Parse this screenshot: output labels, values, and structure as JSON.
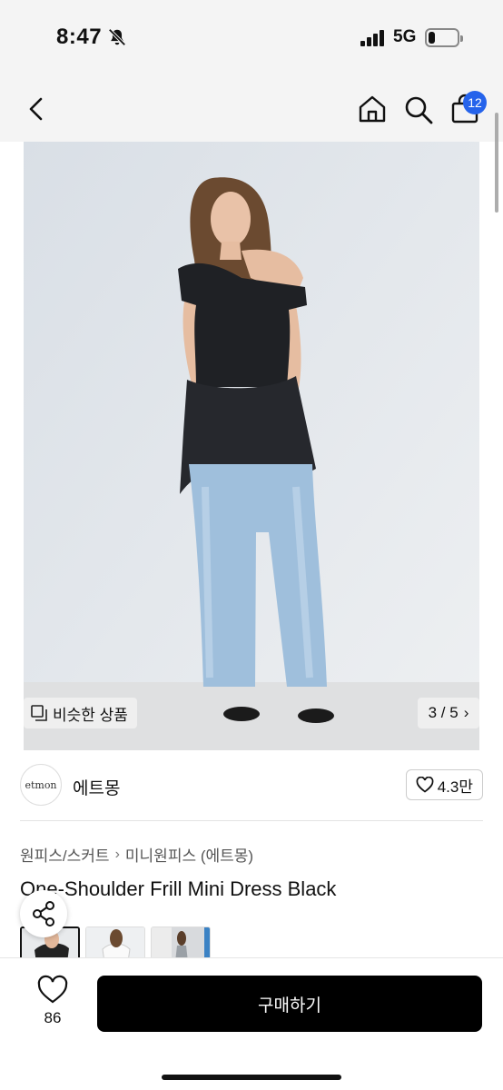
{
  "status_bar": {
    "time": "8:47",
    "network": "5G",
    "battery_level": 0.22
  },
  "nav": {
    "cart_count": "12"
  },
  "gallery": {
    "similar_label": "비슷한 상품",
    "counter": "3 / 5",
    "counter_chevron": "›"
  },
  "store": {
    "logo_text": "etmon",
    "name": "에트몽",
    "likes": "4.3만"
  },
  "breadcrumb": {
    "category": "원피스/스커트",
    "separator": "›",
    "subcategory": "미니원피스 (에트몽)"
  },
  "product": {
    "title": "One-Shoulder Frill Mini Dress Black"
  },
  "bottom": {
    "wish_count": "86",
    "buy_label": "구매하기"
  },
  "colors": {
    "badge": "#2563eb",
    "buy_button": "#000000"
  }
}
